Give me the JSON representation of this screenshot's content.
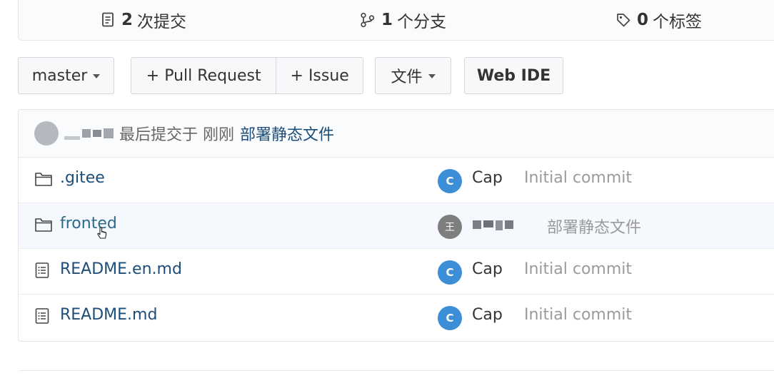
{
  "stats": {
    "commits": {
      "count": "2",
      "label": "次提交"
    },
    "branches": {
      "count": "1",
      "label": "个分支"
    },
    "tags": {
      "count": "0",
      "label": "个标签"
    }
  },
  "toolbar": {
    "branch_select": "master",
    "pull_request": "+ Pull Request",
    "issue": "+ Issue",
    "files_menu": "文件",
    "web_ide": "Web IDE"
  },
  "latest_commit": {
    "label": "最后提交于 刚刚",
    "message": "部署静态文件"
  },
  "files": [
    {
      "name": ".gitee",
      "type": "folder",
      "avatar": "C",
      "author": "Cap",
      "message": "Initial commit"
    },
    {
      "name": "fronted",
      "type": "folder",
      "avatar": "王",
      "author": "",
      "message": "部署静态文件"
    },
    {
      "name": "README.en.md",
      "type": "file",
      "avatar": "C",
      "author": "Cap",
      "message": "Initial commit"
    },
    {
      "name": "README.md",
      "type": "file",
      "avatar": "C",
      "author": "Cap",
      "message": "Initial commit"
    }
  ],
  "colors": {
    "link": "#1d4e7a",
    "avatar_blue": "#3c8fd6",
    "avatar_gray": "#7e7e7e"
  }
}
